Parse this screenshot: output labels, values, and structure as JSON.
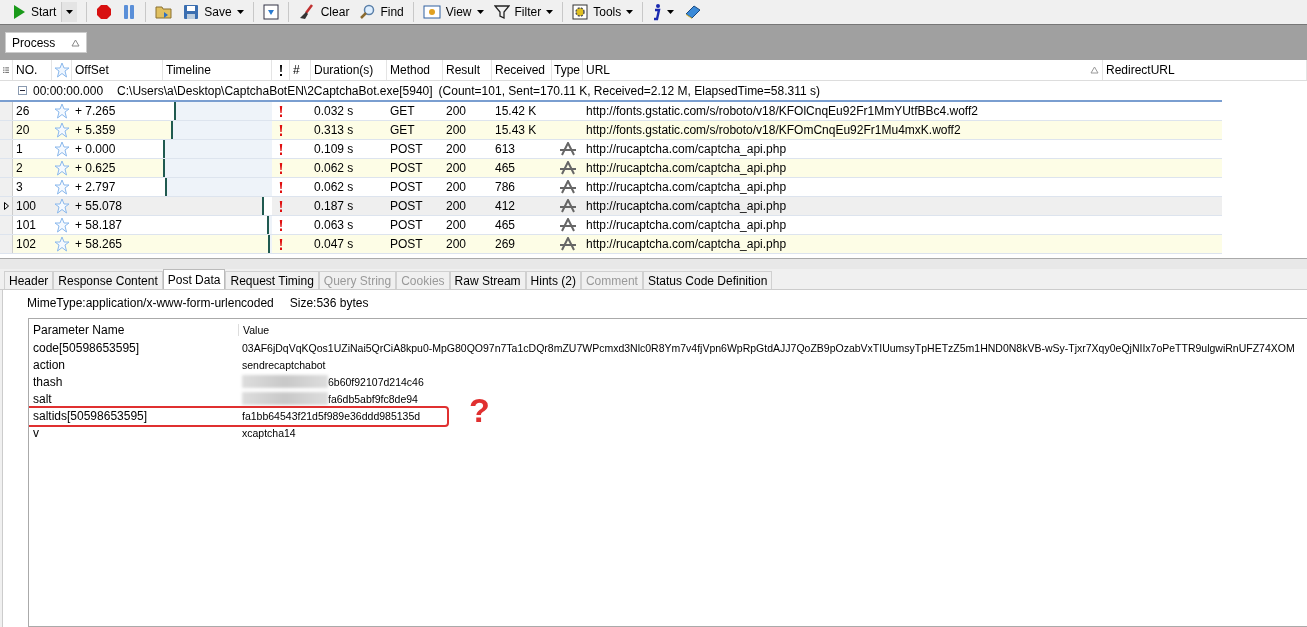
{
  "toolbar": [
    {
      "kind": "start",
      "label": "Start",
      "dropdown": true
    },
    {
      "kind": "record",
      "dropdown": false
    },
    {
      "kind": "pause",
      "dropdown": false
    },
    {
      "kind": "open",
      "dropdown": false
    },
    {
      "kind": "save",
      "label": "Save",
      "dropdown": true
    },
    {
      "kind": "capture",
      "dropdown": false
    },
    {
      "kind": "clear",
      "label": "Clear",
      "dropdown": false
    },
    {
      "kind": "find",
      "label": "Find",
      "dropdown": false
    },
    {
      "kind": "view",
      "label": "View",
      "dropdown": true
    },
    {
      "kind": "filter",
      "label": "Filter",
      "dropdown": true
    },
    {
      "kind": "tools",
      "label": "Tools",
      "dropdown": true
    },
    {
      "kind": "info",
      "dropdown": true
    },
    {
      "kind": "book",
      "dropdown": false
    }
  ],
  "group_by": {
    "label": "Process"
  },
  "table": {
    "columns": [
      "NO.",
      "OffSet",
      "Timeline",
      "#",
      "Duration(s)",
      "Method",
      "Result",
      "Received",
      "Type",
      "URL",
      "RedirectURL"
    ],
    "group": {
      "expanded": true,
      "time": "00:00:00.000",
      "path": "C:\\Users\\a\\Desktop\\CaptchaBotEN\\2CaptchaBot.exe[5940]",
      "summary": "(Count=101, Sent=170.11 K, Received=2.12 M, ElapsedTime=58.311 s)"
    },
    "rows": [
      {
        "no": "26",
        "offset": "+ 7.265",
        "level": 0.12,
        "duration": "0.032 s",
        "method": "GET",
        "result": "200",
        "received": "15.42 K",
        "type_icon": false,
        "url": "http://fonts.gstatic.com/s/roboto/v18/KFOlCnqEu92Fr1MmYUtfBBc4.woff2",
        "selected": false
      },
      {
        "no": "20",
        "offset": "+ 5.359",
        "level": 0.09,
        "duration": "0.313 s",
        "method": "GET",
        "result": "200",
        "received": "15.43 K",
        "type_icon": false,
        "url": "http://fonts.gstatic.com/s/roboto/v18/KFOmCnqEu92Fr1Mu4mxK.woff2",
        "selected": false
      },
      {
        "no": "1",
        "offset": "+ 0.000",
        "level": 0.01,
        "duration": "0.109 s",
        "method": "POST",
        "result": "200",
        "received": "613",
        "type_icon": true,
        "url": "http://rucaptcha.com/captcha_api.php",
        "selected": false
      },
      {
        "no": "2",
        "offset": "+ 0.625",
        "level": 0.01,
        "duration": "0.062 s",
        "method": "POST",
        "result": "200",
        "received": "465",
        "type_icon": true,
        "url": "http://rucaptcha.com/captcha_api.php",
        "selected": false
      },
      {
        "no": "3",
        "offset": "+ 2.797",
        "level": 0.04,
        "duration": "0.062 s",
        "method": "POST",
        "result": "200",
        "received": "786",
        "type_icon": true,
        "url": "http://rucaptcha.com/captcha_api.php",
        "selected": false
      },
      {
        "no": "100",
        "offset": "+ 55.078",
        "level": 0.93,
        "duration": "0.187 s",
        "method": "POST",
        "result": "200",
        "received": "412",
        "type_icon": true,
        "url": "http://rucaptcha.com/captcha_api.php",
        "selected": true
      },
      {
        "no": "101",
        "offset": "+ 58.187",
        "level": 0.97,
        "duration": "0.063 s",
        "method": "POST",
        "result": "200",
        "received": "465",
        "type_icon": true,
        "url": "http://rucaptcha.com/captcha_api.php",
        "selected": false
      },
      {
        "no": "102",
        "offset": "+ 58.265",
        "level": 0.98,
        "duration": "0.047 s",
        "method": "POST",
        "result": "200",
        "received": "269",
        "type_icon": true,
        "url": "http://rucaptcha.com/captcha_api.php",
        "selected": false
      }
    ]
  },
  "tabs": [
    {
      "label": "Header",
      "selected": false,
      "disabled": false
    },
    {
      "label": "Response Content",
      "selected": false,
      "disabled": false
    },
    {
      "label": "Post Data",
      "selected": true,
      "disabled": false
    },
    {
      "label": "Request Timing",
      "selected": false,
      "disabled": false
    },
    {
      "label": "Query String",
      "selected": false,
      "disabled": true
    },
    {
      "label": "Cookies",
      "selected": false,
      "disabled": true
    },
    {
      "label": "Raw Stream",
      "selected": false,
      "disabled": false
    },
    {
      "label": "Hints (2)",
      "selected": false,
      "disabled": false
    },
    {
      "label": "Comment",
      "selected": false,
      "disabled": true
    },
    {
      "label": "Status Code Definition",
      "selected": false,
      "disabled": false
    }
  ],
  "post_data": {
    "mime_type": "MimeType:application/x-www-form-urlencoded",
    "size": "Size:536 bytes",
    "columns": [
      "Parameter Name",
      "Value"
    ],
    "params": [
      {
        "name": "code[50598653595]",
        "value": "03AF6jDqVqKQos1UZiNai5QrCiA8kpu0-MpG80QO97n7Ta1cDQr8mZU7WPcmxd3Nlc0R8Ym7v4fjVpn6WpRpGtdAJJ7QoZB9pOzabVxTIUumsyTpHETzZ5m1HND0N8kVB-wSy-Tjxr7Xqy0eQjNIIx7oPeTTR9ulgwiRnUFZ74XOM",
        "blurred": false,
        "highlighted": false
      },
      {
        "name": "action",
        "value": "sendrecaptchabot",
        "blurred": false,
        "highlighted": false
      },
      {
        "name": "thash",
        "value": "6b60f92107d214c46",
        "blurred": true,
        "highlighted": false
      },
      {
        "name": "salt",
        "value": "fa6db5abf9fc8de94",
        "blurred": true,
        "highlighted": false
      },
      {
        "name": "saltids[50598653595]",
        "value": "fa1bb64543f21d5f989e36ddd985135d",
        "blurred": false,
        "highlighted": true
      },
      {
        "name": "v",
        "value": "xcaptcha14",
        "blurred": false,
        "highlighted": false
      }
    ],
    "annotation": "?"
  }
}
